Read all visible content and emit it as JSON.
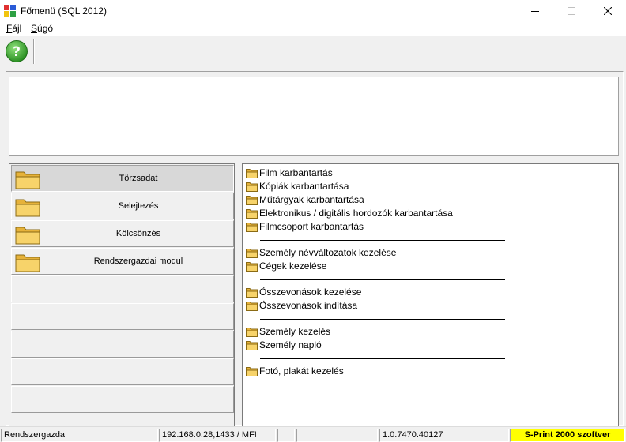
{
  "window": {
    "title": "Főmenü (SQL 2012)",
    "min_icon": "minimize-icon",
    "max_icon": "maximize-icon",
    "close_icon": "close-icon"
  },
  "menubar": {
    "items": [
      {
        "accel": "F",
        "rest": "ájl"
      },
      {
        "accel": "S",
        "rest": "úgó"
      }
    ]
  },
  "toolbar": {
    "help_icon": "help-question-icon"
  },
  "nav": {
    "buttons": [
      {
        "label": "Törzsadat",
        "active": true
      },
      {
        "label": "Selejtezés",
        "active": false
      },
      {
        "label": "Kölcsönzés",
        "active": false
      },
      {
        "label": "Rendszergazdai modul",
        "active": false
      },
      {
        "label": "",
        "active": false
      },
      {
        "label": "",
        "active": false
      },
      {
        "label": "",
        "active": false
      },
      {
        "label": "",
        "active": false
      },
      {
        "label": "",
        "active": false
      }
    ]
  },
  "list": {
    "groups": [
      [
        "Film karbantartás",
        "Kópiák karbantartása",
        "Műtárgyak karbantartása",
        "Elektronikus / digitális hordozók karbantartása",
        "Filmcsoport karbantartás"
      ],
      [
        "Személy névváltozatok kezelése",
        "Cégek kezelése"
      ],
      [
        "Összevonások kezelése",
        "Összevonások indítása"
      ],
      [
        "Személy kezelés",
        "Személy napló"
      ],
      [
        "Fotó, plakát kezelés"
      ]
    ]
  },
  "status": {
    "user": "Rendszergazda",
    "server": "192.168.0.28,1433 / MFI",
    "empty1": "",
    "empty2": "",
    "version": "1.0.7470.40127",
    "brand": "S-Print 2000 szoftver"
  },
  "colors": {
    "brand_bg": "#ffff00",
    "folder": "#f2c94c",
    "help_green": "#3aa32e"
  }
}
